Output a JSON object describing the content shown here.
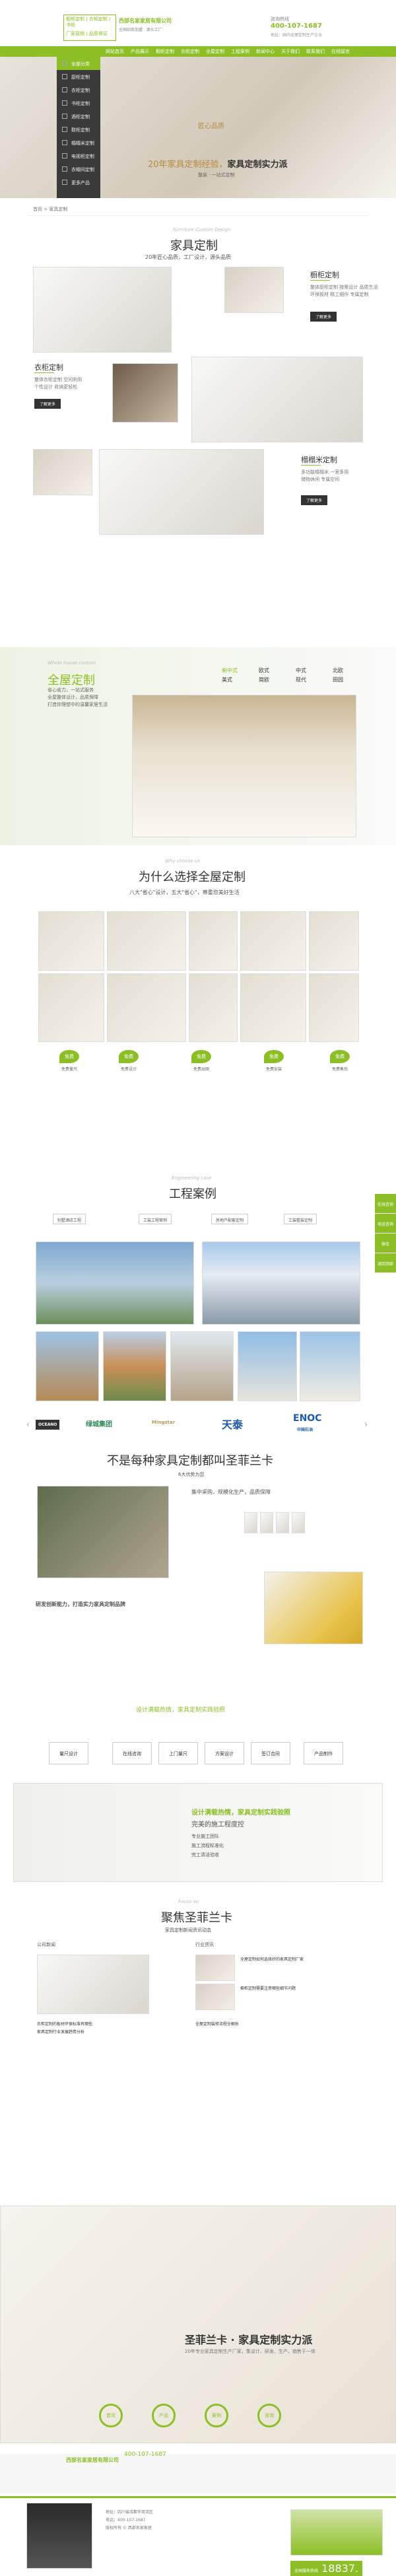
{
  "header": {
    "logo_lines": [
      "橱柜定制 | 衣柜定制 | 书柜",
      "厂家直销 | 品质保证"
    ],
    "brand": "西部名家家居有限公司",
    "brand_sub": "全国招商加盟 · 源头工厂",
    "hotline_label": "咨询热线",
    "hotline": "400-107-1687",
    "address": "地址：国内全屋定制生产企业"
  },
  "nav": [
    "网站首页",
    "产品展示",
    "橱柜定制",
    "衣柜定制",
    "全屋定制",
    "工程案例",
    "新闻中心",
    "关于我们",
    "联系我们",
    "在线留言"
  ],
  "sidebar": [
    "全部分类",
    "厨柜定制",
    "衣柜定制",
    "书柜定制",
    "酒柜定制",
    "鞋柜定制",
    "榻榻米定制",
    "电视柜定制",
    "衣帽间定制",
    "更多产品"
  ],
  "hero": {
    "badge": "匠心品质",
    "title_a": "20年家具定制经验，",
    "title_b": "家具定制实力派",
    "sub": "整装 · 一站式定制"
  },
  "breadcrumb": "首页 > 家具定制",
  "custom": {
    "eng": "Furniture Custom Design",
    "title": "家具定制",
    "sub": "20年匠心品质，工厂设计，源头品质",
    "items": [
      {
        "title": "橱柜定制",
        "desc": "整体厨柜定制  按需设计  品质生活\n环保板材  精工细作  专属定制",
        "btn": "了解更多"
      },
      {
        "title": "衣柜定制",
        "desc": "整体衣柜定制  空间利用\n个性设计  收纳更轻松",
        "btn": "了解更多"
      },
      {
        "title": "榻榻米定制",
        "desc": "多功能榻榻米  一室多用\n储物休闲  专属空间",
        "btn": "了解更多"
      }
    ]
  },
  "whole": {
    "eng": "Whole house custom",
    "title": "全屋定制",
    "desc": "省心省力，一站式服务\n全屋整体设计，品质保障\n打造你理想中的温馨家居生活",
    "styles": [
      "新中式",
      "欧式",
      "中式",
      "北欧",
      "美式",
      "简欧",
      "现代",
      "田园"
    ]
  },
  "why": {
    "eng": "Why choose us",
    "title": "为什么选择全屋定制",
    "sub": "八大\"省心\"设计，五大\"省心\"，尊重您美好生活",
    "leaves": [
      "免费",
      "免费",
      "免费",
      "免费",
      "免费"
    ],
    "leaf_caps": [
      "免费量尺",
      "免费设计",
      "免费出图",
      "免费安装",
      "免费售后"
    ]
  },
  "projects": {
    "eng": "Engineering case",
    "title": "工程案例",
    "tabs": [
      "别墅酒店工程",
      "工装工程案例",
      "房地产配套定制",
      "工装整装定制"
    ],
    "logos": [
      "OCEANO",
      "绿城集团",
      "Mingstar",
      "天泰",
      "ENOC",
      "中国石油"
    ]
  },
  "brand_section": {
    "title": "不是每种家具定制都叫圣菲兰卡",
    "sub": "6大优势为您",
    "points": [
      "集中采购，规模化生产，品质保障",
      "研发创新能力，打造优质家居定制品牌"
    ],
    "cert_title": "研发创新能力，打造实力家具定制品牌"
  },
  "process": {
    "title": "设计满载热情，家具定制实践验照",
    "steps": [
      "量尺设计",
      "在线咨询",
      "上门量尺",
      "方案设计",
      "签订合同",
      "产品制作"
    ]
  },
  "service": {
    "title": "完美的施工程度控",
    "items": [
      "专业施工团队",
      "施工流程标准化",
      "完工清洁验收"
    ]
  },
  "news": {
    "eng": "Focus on",
    "title": "聚焦圣菲兰卡",
    "sub": "家具定制新闻资讯动态",
    "tab_left": "公司新闻",
    "tab_right": "行业资讯",
    "headlines": [
      "全屋定制如何选择好的家具定制厂家",
      "橱柜定制需要注意哪些细节问题",
      "衣柜定制的板材环保标准有哪些",
      "家具定制行业发展趋势分析",
      "全屋定制装修流程全解析"
    ]
  },
  "bottom_banner": {
    "title": "圣菲兰卡 · 家具定制实力派",
    "desc": "20年专业家具定制生产厂家，集设计、研发、生产、销售于一体"
  },
  "footer": {
    "logo": "西部名家家居有限公司",
    "phone": "400-107-1687",
    "circles": [
      "首页",
      "产品",
      "案例",
      "咨询"
    ],
    "contact_lines": [
      "地址：四川省成都市双流区",
      "电话：400-107-1687",
      "版权所有 © 西部名家家居"
    ],
    "hot_label": "全国服务热线",
    "hot_num": "18837."
  },
  "float_bar": [
    "在线咨询",
    "电话咨询",
    "微信",
    "返回顶部"
  ]
}
